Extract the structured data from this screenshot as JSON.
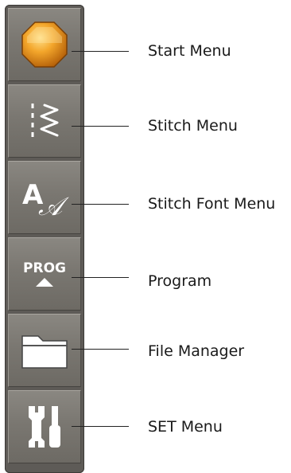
{
  "menu": {
    "items": [
      {
        "id": "start",
        "label": "Start Menu",
        "icon": "orange-octagon-icon"
      },
      {
        "id": "stitch",
        "label": "Stitch Menu",
        "icon": "stitch-icon"
      },
      {
        "id": "stitch-font",
        "label": "Stitch Font Menu",
        "icon": "stitch-font-icon"
      },
      {
        "id": "program",
        "label": "Program",
        "icon": "prog-icon",
        "icon_text": "PROG"
      },
      {
        "id": "file-manager",
        "label": "File Manager",
        "icon": "folder-icon"
      },
      {
        "id": "set",
        "label": "SET Menu",
        "icon": "tools-icon"
      }
    ]
  },
  "colors": {
    "panel": "#5e5b57",
    "button": "#7a7771",
    "accent_orange": "#e99a1f",
    "icon_white": "#ffffff"
  }
}
